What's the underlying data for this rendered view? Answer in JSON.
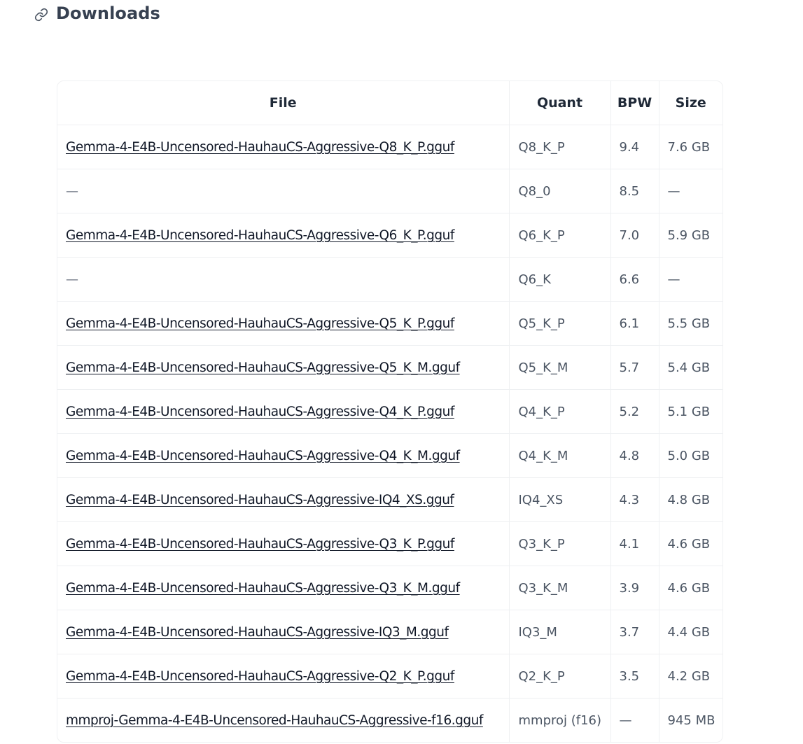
{
  "section": {
    "title": "Downloads",
    "icon": "link-icon"
  },
  "table": {
    "headers": {
      "file": "File",
      "quant": "Quant",
      "bpw": "BPW",
      "size": "Size"
    },
    "rows": [
      {
        "file": "Gemma-4-E4B-Uncensored-HauhauCS-Aggressive-Q8_K_P.gguf",
        "is_link": true,
        "quant": "Q8_K_P",
        "bpw": "9.4",
        "size": "7.6 GB"
      },
      {
        "file": "—",
        "is_link": false,
        "quant": "Q8_0",
        "bpw": "8.5",
        "size": "—"
      },
      {
        "file": "Gemma-4-E4B-Uncensored-HauhauCS-Aggressive-Q6_K_P.gguf",
        "is_link": true,
        "quant": "Q6_K_P",
        "bpw": "7.0",
        "size": "5.9 GB"
      },
      {
        "file": "—",
        "is_link": false,
        "quant": "Q6_K",
        "bpw": "6.6",
        "size": "—"
      },
      {
        "file": "Gemma-4-E4B-Uncensored-HauhauCS-Aggressive-Q5_K_P.gguf",
        "is_link": true,
        "quant": "Q5_K_P",
        "bpw": "6.1",
        "size": "5.5 GB"
      },
      {
        "file": "Gemma-4-E4B-Uncensored-HauhauCS-Aggressive-Q5_K_M.gguf",
        "is_link": true,
        "quant": "Q5_K_M",
        "bpw": "5.7",
        "size": "5.4 GB"
      },
      {
        "file": "Gemma-4-E4B-Uncensored-HauhauCS-Aggressive-Q4_K_P.gguf",
        "is_link": true,
        "quant": "Q4_K_P",
        "bpw": "5.2",
        "size": "5.1 GB"
      },
      {
        "file": "Gemma-4-E4B-Uncensored-HauhauCS-Aggressive-Q4_K_M.gguf",
        "is_link": true,
        "quant": "Q4_K_M",
        "bpw": "4.8",
        "size": "5.0 GB"
      },
      {
        "file": "Gemma-4-E4B-Uncensored-HauhauCS-Aggressive-IQ4_XS.gguf",
        "is_link": true,
        "quant": "IQ4_XS",
        "bpw": "4.3",
        "size": "4.8 GB"
      },
      {
        "file": "Gemma-4-E4B-Uncensored-HauhauCS-Aggressive-Q3_K_P.gguf",
        "is_link": true,
        "quant": "Q3_K_P",
        "bpw": "4.1",
        "size": "4.6 GB"
      },
      {
        "file": "Gemma-4-E4B-Uncensored-HauhauCS-Aggressive-Q3_K_M.gguf",
        "is_link": true,
        "quant": "Q3_K_M",
        "bpw": "3.9",
        "size": "4.6 GB"
      },
      {
        "file": "Gemma-4-E4B-Uncensored-HauhauCS-Aggressive-IQ3_M.gguf",
        "is_link": true,
        "quant": "IQ3_M",
        "bpw": "3.7",
        "size": "4.4 GB"
      },
      {
        "file": "Gemma-4-E4B-Uncensored-HauhauCS-Aggressive-Q2_K_P.gguf",
        "is_link": true,
        "quant": "Q2_K_P",
        "bpw": "3.5",
        "size": "4.2 GB"
      },
      {
        "file": "mmproj-Gemma-4-E4B-Uncensored-HauhauCS-Aggressive-f16.gguf",
        "is_link": true,
        "quant": "mmproj (f16)",
        "bpw": "—",
        "size": "945 MB"
      }
    ]
  }
}
